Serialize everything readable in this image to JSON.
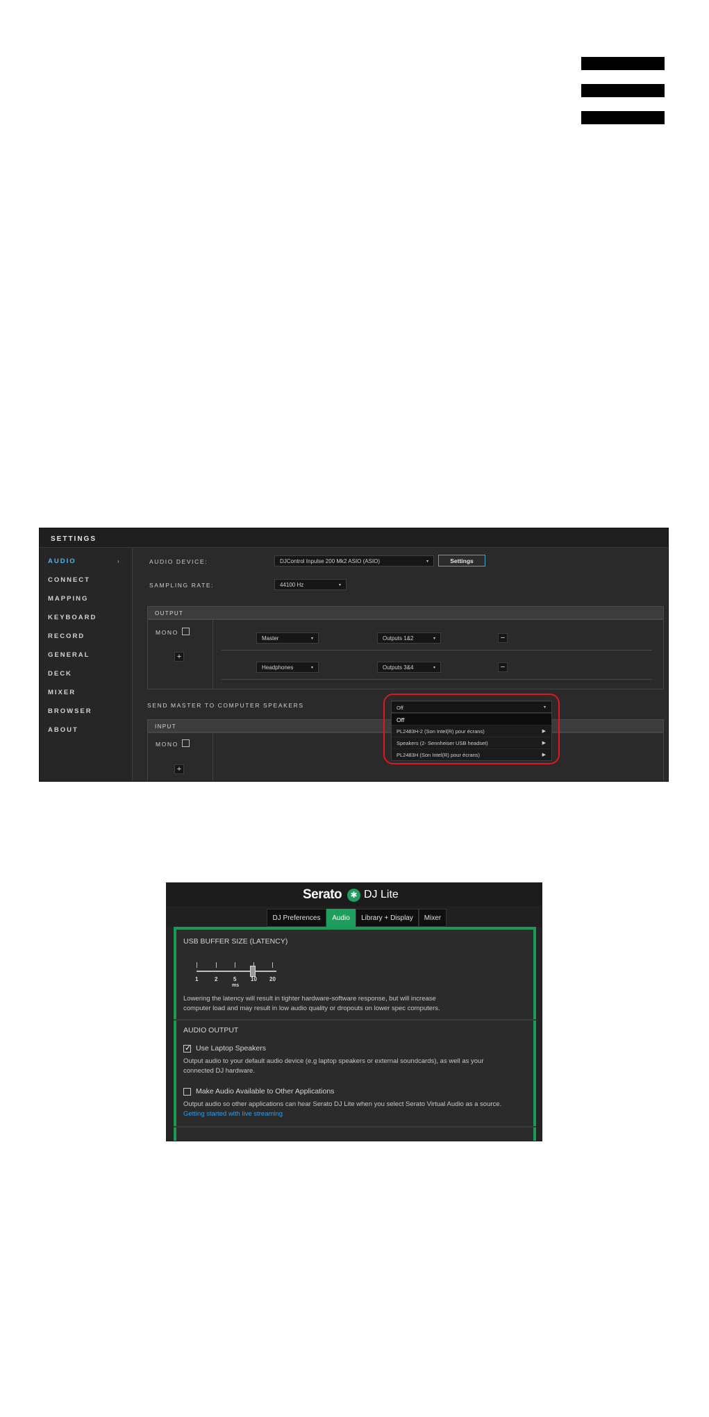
{
  "menu": {
    "icon": "hamburger-icon"
  },
  "settings": {
    "title": "SETTINGS",
    "nav": [
      {
        "label": "AUDIO",
        "active": true,
        "arrow": "›"
      },
      {
        "label": "CONNECT"
      },
      {
        "label": "MAPPING"
      },
      {
        "label": "KEYBOARD"
      },
      {
        "label": "RECORD"
      },
      {
        "label": "GENERAL"
      },
      {
        "label": "DECK"
      },
      {
        "label": "MIXER"
      },
      {
        "label": "BROWSER"
      },
      {
        "label": "ABOUT"
      }
    ],
    "audio_device_label": "AUDIO DEVICE:",
    "audio_device_value": "DJControl Inpulse 200 Mk2 ASIO (ASIO)",
    "settings_button": "Settings",
    "sampling_rate_label": "SAMPLING RATE:",
    "sampling_rate_value": "44100 Hz",
    "output_header": "OUTPUT",
    "mono_label": "MONO",
    "outputs": [
      {
        "channel": "Master",
        "route": "Outputs 1&2"
      },
      {
        "channel": "Headphones",
        "route": "Outputs 3&4"
      }
    ],
    "send_master_label": "SEND MASTER TO COMPUTER SPEAKERS",
    "send_master_value": "Off",
    "dropdown_options": [
      "Off",
      "PL2483H-2 (Son Intel(R) pour écrans)",
      "Speakers (2- Sennheiser USB headset)",
      "PL2483H (Son Intel(R) pour écrans)"
    ],
    "input_header": "INPUT",
    "input_mono_label": "MONO",
    "plus": "+",
    "minus": "−",
    "caret": "▾",
    "submenu_arrow": "▶",
    "highlight_color": "#e3151d",
    "accent_color": "#4fb6e6"
  },
  "serato": {
    "brand": "Serato",
    "product": "DJ Lite",
    "logo_glyph": "✱",
    "tabs": [
      {
        "label": "DJ Preferences"
      },
      {
        "label": "Audio",
        "active": true
      },
      {
        "label": "Library + Display"
      },
      {
        "label": "Mixer"
      }
    ],
    "usb_buffer_title": "USB BUFFER SIZE (LATENCY)",
    "latency_ticks": [
      "1",
      "2",
      "5",
      "10",
      "20"
    ],
    "latency_unit": "ms",
    "latency_selected_ms": 10,
    "latency_note_1": "Lowering the latency will result in tighter hardware-software response, but will increase",
    "latency_note_2": "computer load and may result in low audio quality or dropouts on lower spec computers.",
    "audio_output_title": "AUDIO OUTPUT",
    "use_laptop_speakers": {
      "label": "Use Laptop Speakers",
      "checked": true
    },
    "laptop_note_1": "Output audio to your default audio device (e.g laptop speakers or external soundcards), as well as your",
    "laptop_note_2": "connected DJ hardware.",
    "make_available": {
      "label": "Make Audio Available to Other Applications",
      "checked": false
    },
    "available_note": "Output audio so other applications can hear Serato DJ Lite when you select Serato Virtual Audio as a source.",
    "streaming_link": "Getting started with live streaming",
    "accent_color": "#1b9a56",
    "link_color": "#2f9ce8"
  }
}
